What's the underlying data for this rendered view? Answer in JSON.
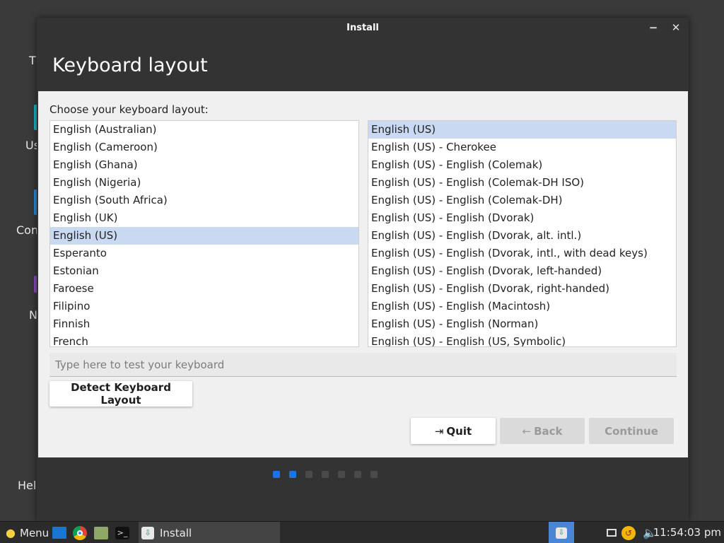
{
  "window": {
    "title": "Install",
    "minimize_glyph": "−",
    "close_glyph": "✕"
  },
  "page": {
    "heading": "Keyboard layout",
    "choose_label": "Choose your keyboard layout:"
  },
  "layouts": [
    {
      "label": "English (Australian)",
      "selected": false
    },
    {
      "label": "English (Cameroon)",
      "selected": false
    },
    {
      "label": "English (Ghana)",
      "selected": false
    },
    {
      "label": "English (Nigeria)",
      "selected": false
    },
    {
      "label": "English (South Africa)",
      "selected": false
    },
    {
      "label": "English (UK)",
      "selected": false
    },
    {
      "label": "English (US)",
      "selected": true
    },
    {
      "label": "Esperanto",
      "selected": false
    },
    {
      "label": "Estonian",
      "selected": false
    },
    {
      "label": "Faroese",
      "selected": false
    },
    {
      "label": "Filipino",
      "selected": false
    },
    {
      "label": "Finnish",
      "selected": false
    },
    {
      "label": "French",
      "selected": false
    }
  ],
  "variants": [
    {
      "label": "English (US)",
      "selected": true
    },
    {
      "label": "English (US) - Cherokee",
      "selected": false
    },
    {
      "label": "English (US) - English (Colemak)",
      "selected": false
    },
    {
      "label": "English (US) - English (Colemak-DH ISO)",
      "selected": false
    },
    {
      "label": "English (US) - English (Colemak-DH)",
      "selected": false
    },
    {
      "label": "English (US) - English (Dvorak)",
      "selected": false
    },
    {
      "label": "English (US) - English (Dvorak, alt. intl.)",
      "selected": false
    },
    {
      "label": "English (US) - English (Dvorak, intl., with dead keys)",
      "selected": false
    },
    {
      "label": "English (US) - English (Dvorak, left-handed)",
      "selected": false
    },
    {
      "label": "English (US) - English (Dvorak, right-handed)",
      "selected": false
    },
    {
      "label": "English (US) - English (Macintosh)",
      "selected": false
    },
    {
      "label": "English (US) - English (Norman)",
      "selected": false
    },
    {
      "label": "English (US) - English (US, Symbolic)",
      "selected": false
    }
  ],
  "test_input": {
    "placeholder": "Type here to test your keyboard",
    "value": ""
  },
  "buttons": {
    "detect": "Detect Keyboard Layout",
    "quit": "Quit",
    "quit_icon": "⇥",
    "back": "Back",
    "back_icon": "←",
    "continue": "Continue"
  },
  "progress": {
    "total_steps": 7,
    "active_steps": 2,
    "active_color": "#1a73e8",
    "inactive_color": "#4a4a4a"
  },
  "desktop": {
    "labels": [
      "T",
      "Us",
      "Con",
      "N",
      "Help"
    ]
  },
  "taskbar": {
    "menu_label": "Menu",
    "install_label": "Install",
    "clock": "11:54:03 pm"
  },
  "colors": {
    "selection": "#c9d9f2",
    "window_dark": "#333333",
    "content_bg": "#f0f0f0"
  }
}
